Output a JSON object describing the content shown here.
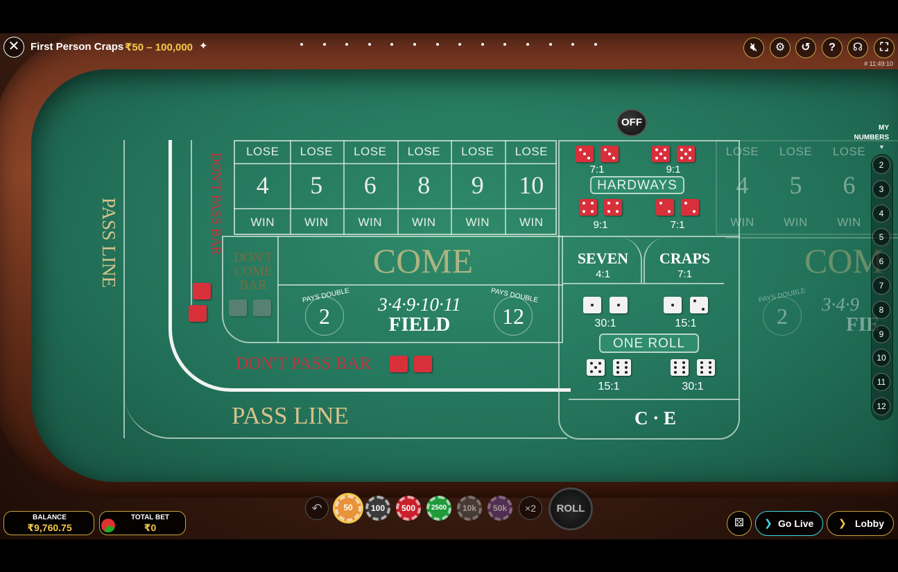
{
  "header": {
    "title": "First Person Craps",
    "limits": "₹50 – 100,000",
    "round_id": "# 11:49:10"
  },
  "table": {
    "pass_line": "PASS LINE",
    "dont_pass_bar": "DON'T PASS BAR",
    "dont_come_bar": "DON'T COME BAR",
    "come": "COME",
    "field": "FIELD",
    "field_numbers": "3·4·9·10·11",
    "pays_double": "PAYS DOUBLE",
    "field_2": "2",
    "field_12": "12",
    "off_puck": "OFF",
    "lose": "LOSE",
    "win": "WIN",
    "place_numbers": [
      "4",
      "5",
      "6",
      "8",
      "9",
      "10"
    ],
    "right_place_numbers": [
      "4",
      "5",
      "6"
    ],
    "hardways_label": "HARDWAYS",
    "hardways_odds": [
      "7:1",
      "9:1",
      "9:1",
      "7:1"
    ],
    "seven": "SEVEN",
    "seven_odds": "4:1",
    "craps": "CRAPS",
    "craps_odds": "7:1",
    "one_roll_label": "ONE ROLL",
    "one_roll_odds": [
      "30:1",
      "15:1",
      "15:1",
      "30:1"
    ],
    "ce": "C · E",
    "right_come": "COM",
    "right_field": "FIE",
    "right_field_numbers": "3·4·9"
  },
  "my_numbers": {
    "label_1": "MY",
    "label_2": "NUMBERS",
    "values": [
      "2",
      "3",
      "4",
      "5",
      "6",
      "7",
      "8",
      "9",
      "10",
      "11",
      "12"
    ]
  },
  "footer": {
    "balance_label": "BALANCE",
    "balance_value": "₹9,760.75",
    "total_bet_label": "TOTAL BET",
    "total_bet_value": "₹0",
    "chips": [
      "50",
      "100",
      "500",
      "2500",
      "10k",
      "50k"
    ],
    "double_label": "×2",
    "roll_label": "ROLL",
    "go_live_label": "Go Live",
    "lobby_label": "Lobby"
  },
  "colors": {
    "felt": "#23735a",
    "accent_gold": "#c9a640",
    "limits_gold": "#f2c94c",
    "red_text": "#c43440",
    "live_cyan": "#41d9e6"
  }
}
